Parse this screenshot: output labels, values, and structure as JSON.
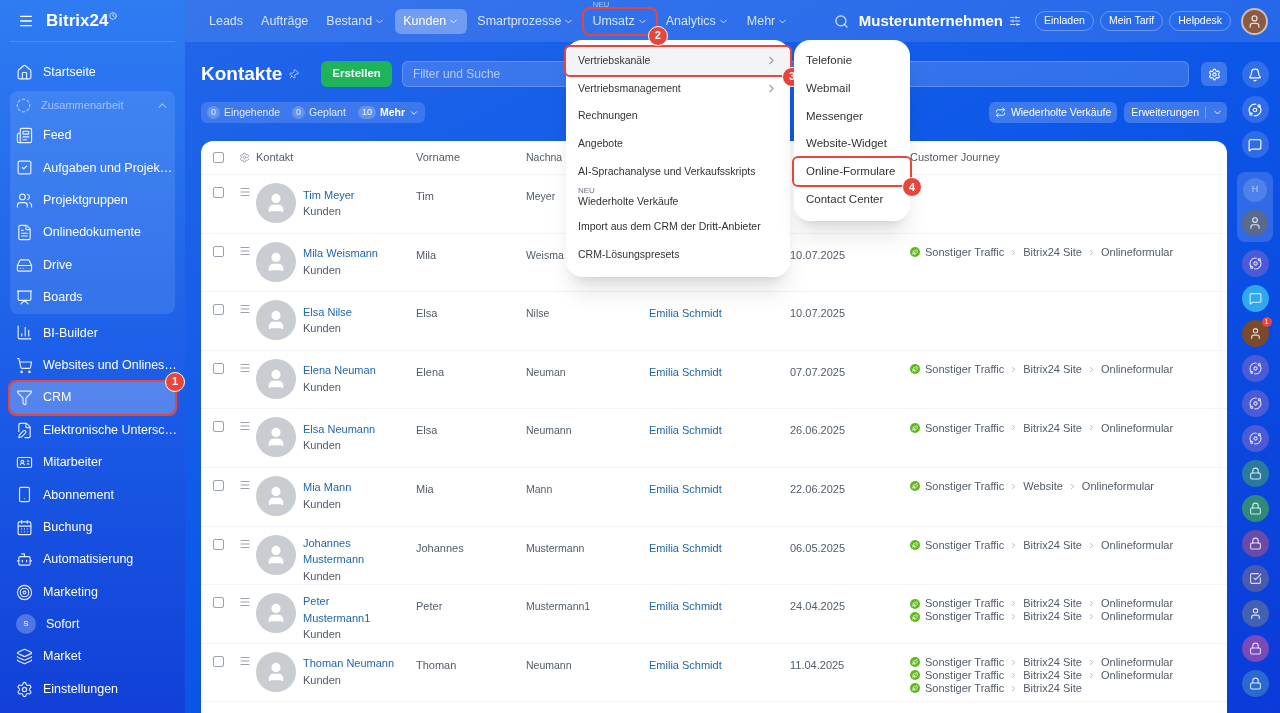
{
  "sidebar": {
    "logo": "Bitrix24",
    "items": [
      {
        "label": "Startseite",
        "selected": false
      },
      {
        "label": "Zusammenarbeit",
        "expanded": true,
        "children": [
          {
            "label": "Feed",
            "selected": false
          },
          {
            "label": "Aufgaben und Projek…",
            "selected": false
          },
          {
            "label": "Projektgruppen",
            "selected": false
          },
          {
            "label": "Onlinedokumente",
            "selected": false
          },
          {
            "label": "Drive",
            "selected": false
          },
          {
            "label": "Boards",
            "selected": false
          }
        ]
      },
      {
        "label": "BI-Builder",
        "selected": false
      },
      {
        "label": "Websites und Onlines…",
        "selected": false
      },
      {
        "label": "CRM",
        "selected": true,
        "callout": "1"
      },
      {
        "label": "Elektronische Untersc…",
        "selected": false
      },
      {
        "label": "Mitarbeiter",
        "selected": false
      },
      {
        "label": "Abonnement",
        "selected": false
      },
      {
        "label": "Buchung",
        "selected": false
      },
      {
        "label": "Automatisierung",
        "selected": false
      },
      {
        "label": "Marketing",
        "selected": false
      },
      {
        "label": "Sofort",
        "selected": false,
        "avatar_letter": "S"
      },
      {
        "label": "Market",
        "selected": false
      },
      {
        "label": "Einstellungen",
        "selected": false
      }
    ]
  },
  "topnav": {
    "items": [
      {
        "label": "Leads",
        "selected": false,
        "dropdown": false
      },
      {
        "label": "Aufträge",
        "selected": false,
        "dropdown": false
      },
      {
        "label": "Bestand",
        "selected": false,
        "dropdown": true
      },
      {
        "label": "Kunden",
        "selected": true,
        "dropdown": true
      },
      {
        "label": "Smartprozesse",
        "selected": false,
        "dropdown": true
      },
      {
        "label": "Umsatz",
        "selected": false,
        "dropdown": true,
        "badge": "NEU",
        "callout": "2"
      },
      {
        "label": "Analytics",
        "selected": false,
        "dropdown": true
      },
      {
        "label": "Mehr",
        "selected": false,
        "dropdown": true
      }
    ],
    "company": "Musterunternehmen",
    "buttons": [
      "Einladen",
      "Mein Tarif",
      "Helpdesk"
    ]
  },
  "page": {
    "title": "Kontakte",
    "create_button": "Erstellen",
    "search": {
      "placeholder": "Filter und Suche"
    },
    "counters": [
      {
        "count": "0",
        "label": "Eingehende"
      },
      {
        "count": "0",
        "label": "Geplant"
      }
    ],
    "more": {
      "count": "10",
      "label": "Mehr"
    },
    "repeat_sales_button": "Wiederholte Verkäufe",
    "extensions_button": "Erweiterungen"
  },
  "table": {
    "select_all": false,
    "columns": {
      "contact": "Kontakt",
      "first_name": "Vorname",
      "last_name": "Nachna",
      "journey": "Customer Journey"
    },
    "rows": [
      {
        "checked": false,
        "name": "Tim Meyer",
        "type": "Kunden",
        "first_name": "Tim",
        "last_name": "Meyer",
        "journey": []
      },
      {
        "checked": false,
        "name": "Mila Weismann",
        "type": "Kunden",
        "first_name": "Mila",
        "last_name": "Weisma",
        "date": "10.07.2025",
        "journey": [
          [
            "Sonstiger Traffic",
            "Bitrix24 Site",
            "Onlineformular"
          ]
        ]
      },
      {
        "checked": false,
        "name": "Elsa Nilse",
        "type": "Kunden",
        "first_name": "Elsa",
        "last_name": "Nilse",
        "responsible": "Emilia Schmidt",
        "date": "10.07.2025",
        "journey": []
      },
      {
        "checked": false,
        "name": "Elena Neuman",
        "type": "Kunden",
        "first_name": "Elena",
        "last_name": "Neuman",
        "responsible": "Emilia Schmidt",
        "date": "07.07.2025",
        "journey": [
          [
            "Sonstiger Traffic",
            "Bitrix24 Site",
            "Onlineformular"
          ]
        ]
      },
      {
        "checked": false,
        "name": "Elsa Neumann",
        "type": "Kunden",
        "first_name": "Elsa",
        "last_name": "Neumann",
        "responsible": "Emilia Schmidt",
        "date": "26.06.2025",
        "journey": [
          [
            "Sonstiger Traffic",
            "Bitrix24 Site",
            "Onlineformular"
          ]
        ]
      },
      {
        "checked": false,
        "name": "Mia Mann",
        "type": "Kunden",
        "first_name": "Mia",
        "last_name": "Mann",
        "responsible": "Emilia Schmidt",
        "date": "22.06.2025",
        "journey": [
          [
            "Sonstiger Traffic",
            "Website",
            "Onlineformular"
          ]
        ]
      },
      {
        "checked": false,
        "name": "Johannes Mustermann",
        "type": "Kunden",
        "first_name": "Johannes",
        "last_name": "Mustermann",
        "responsible": "Emilia Schmidt",
        "date": "06.05.2025",
        "journey": [
          [
            "Sonstiger Traffic",
            "Bitrix24 Site",
            "Onlineformular"
          ]
        ]
      },
      {
        "checked": false,
        "name": "Peter Mustermann1",
        "type": "Kunden",
        "first_name": "Peter",
        "last_name": "Mustermann1",
        "responsible": "Emilia Schmidt",
        "date": "24.04.2025",
        "journey": [
          [
            "Sonstiger Traffic",
            "Bitrix24 Site",
            "Onlineformular"
          ],
          [
            "Sonstiger Traffic",
            "Bitrix24 Site",
            "Onlineformular"
          ]
        ]
      },
      {
        "checked": false,
        "name": "Thoman Neumann",
        "type": "Kunden",
        "first_name": "Thoman",
        "last_name": "Neumann",
        "responsible": "Emilia Schmidt",
        "date": "11.04.2025",
        "journey": [
          [
            "Sonstiger Traffic",
            "Bitrix24 Site",
            "Onlineformular"
          ],
          [
            "Sonstiger Traffic",
            "Bitrix24 Site",
            "Onlineformular"
          ],
          [
            "Sonstiger Traffic",
            "Bitrix24 Site"
          ]
        ]
      }
    ]
  },
  "menu": {
    "items": [
      {
        "label": "Vertriebskanäle",
        "submenu": true,
        "selected": true,
        "callout": "3"
      },
      {
        "label": "Vertriebsmanagement",
        "submenu": true,
        "selected": false
      },
      {
        "label": "Rechnungen",
        "submenu": false,
        "selected": false
      },
      {
        "label": "Angebote",
        "submenu": false,
        "selected": false
      },
      {
        "label": "AI-Sprachanalyse und Verkaufsskripts",
        "submenu": false,
        "selected": false
      },
      {
        "label": "Wiederholte Verkäufe",
        "submenu": false,
        "selected": false,
        "badge": "NEU"
      },
      {
        "label": "Import aus dem CRM der Dritt-Anbieter",
        "submenu": false,
        "selected": false
      },
      {
        "label": "CRM-Lösungspresets",
        "submenu": false,
        "selected": false
      }
    ]
  },
  "submenu": {
    "items": [
      {
        "label": "Telefonie",
        "selected": false
      },
      {
        "label": "Webmail",
        "selected": false
      },
      {
        "label": "Messenger",
        "selected": false
      },
      {
        "label": "Website-Widget",
        "selected": false
      },
      {
        "label": "Online-Formulare",
        "selected": false,
        "callout": "4"
      },
      {
        "label": "Contact Center",
        "selected": false
      }
    ]
  },
  "rail": {
    "group_letter": "H",
    "avatar_badge": "1"
  }
}
